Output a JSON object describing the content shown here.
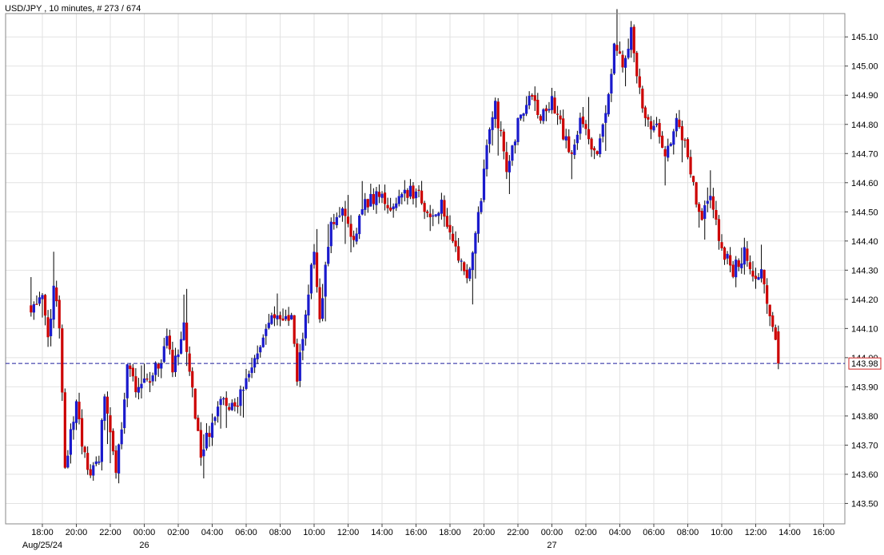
{
  "window": {
    "title": "USD/JPY , 10 minutes, # 273 / 674"
  },
  "current_price_label": "143.98",
  "chart_data": {
    "type": "candlestick",
    "symbol": "USD/JPY",
    "timeframe": "10 minutes",
    "ylim": [
      143.43,
      145.18
    ],
    "y_ticks": [
      "145.10",
      "145.00",
      "144.90",
      "144.80",
      "144.70",
      "144.60",
      "144.50",
      "144.40",
      "144.30",
      "144.20",
      "144.10",
      "144.00",
      "143.90",
      "143.80",
      "143.70",
      "143.60",
      "143.50"
    ],
    "x_ticks": [
      "18:00",
      "20:00",
      "22:00",
      "00:00",
      "02:00",
      "04:00",
      "06:00",
      "08:00",
      "10:00",
      "12:00",
      "14:00",
      "16:00",
      "18:00",
      "20:00",
      "22:00",
      "00:00",
      "02:00",
      "04:00",
      "06:00",
      "08:00",
      "10:00",
      "12:00",
      "14:00",
      "16:00"
    ],
    "date_labels": [
      {
        "label": "Aug/25/24",
        "at_tick": 0
      },
      {
        "label": "26",
        "at_tick": 3
      },
      {
        "label": "27",
        "at_tick": 15
      }
    ],
    "current_price": 143.98,
    "grid": true,
    "up_color": "#1a1acc",
    "down_color": "#cc0000",
    "price_line_color": "#1f1f9c",
    "keypoints": [
      {
        "t": "17:20",
        "v": 144.18
      },
      {
        "t": "18:00",
        "v": 144.2
      },
      {
        "t": "18:20",
        "v": 144.05
      },
      {
        "t": "18:40",
        "v": 144.25
      },
      {
        "t": "19:00",
        "v": 144.1
      },
      {
        "t": "19:20",
        "v": 143.63
      },
      {
        "t": "20:00",
        "v": 143.83
      },
      {
        "t": "20:40",
        "v": 143.6
      },
      {
        "t": "21:20",
        "v": 143.65
      },
      {
        "t": "21:40",
        "v": 143.88
      },
      {
        "t": "22:20",
        "v": 143.58
      },
      {
        "t": "23:00",
        "v": 143.97
      },
      {
        "t": "23:40",
        "v": 143.88
      },
      {
        "t": "00:40",
        "v": 143.96
      },
      {
        "t": "01:20",
        "v": 144.05
      },
      {
        "t": "01:40",
        "v": 143.96
      },
      {
        "t": "02:20",
        "v": 144.1
      },
      {
        "t": "02:40",
        "v": 143.95
      },
      {
        "t": "03:20",
        "v": 143.67
      },
      {
        "t": "03:50",
        "v": 143.75
      },
      {
        "t": "04:20",
        "v": 143.85
      },
      {
        "t": "05:20",
        "v": 143.82
      },
      {
        "t": "06:40",
        "v": 144.03
      },
      {
        "t": "07:20",
        "v": 144.12
      },
      {
        "t": "08:00",
        "v": 144.14
      },
      {
        "t": "08:40",
        "v": 144.13
      },
      {
        "t": "09:00",
        "v": 143.94
      },
      {
        "t": "09:40",
        "v": 144.22
      },
      {
        "t": "10:00",
        "v": 144.38
      },
      {
        "t": "10:20",
        "v": 144.12
      },
      {
        "t": "11:00",
        "v": 144.47
      },
      {
        "t": "11:40",
        "v": 144.5
      },
      {
        "t": "12:20",
        "v": 144.4
      },
      {
        "t": "12:50",
        "v": 144.52
      },
      {
        "t": "14:00",
        "v": 144.57
      },
      {
        "t": "14:30",
        "v": 144.51
      },
      {
        "t": "15:30",
        "v": 144.57
      },
      {
        "t": "16:10",
        "v": 144.55
      },
      {
        "t": "16:50",
        "v": 144.47
      },
      {
        "t": "17:30",
        "v": 144.52
      },
      {
        "t": "18:20",
        "v": 144.38
      },
      {
        "t": "19:00",
        "v": 144.27
      },
      {
        "t": "19:40",
        "v": 144.48
      },
      {
        "t": "20:20",
        "v": 144.8
      },
      {
        "t": "20:40",
        "v": 144.86
      },
      {
        "t": "21:20",
        "v": 144.65
      },
      {
        "t": "22:00",
        "v": 144.8
      },
      {
        "t": "22:40",
        "v": 144.9
      },
      {
        "t": "23:20",
        "v": 144.82
      },
      {
        "t": "00:00",
        "v": 144.88
      },
      {
        "t": "00:40",
        "v": 144.77
      },
      {
        "t": "01:10",
        "v": 144.68
      },
      {
        "t": "01:40",
        "v": 144.82
      },
      {
        "t": "02:40",
        "v": 144.68
      },
      {
        "t": "03:20",
        "v": 144.88
      },
      {
        "t": "03:40",
        "v": 145.1
      },
      {
        "t": "04:10",
        "v": 144.98
      },
      {
        "t": "04:40",
        "v": 145.12
      },
      {
        "t": "05:20",
        "v": 144.85
      },
      {
        "t": "05:40",
        "v": 144.8
      },
      {
        "t": "06:20",
        "v": 144.78
      },
      {
        "t": "06:40",
        "v": 144.7
      },
      {
        "t": "07:20",
        "v": 144.8
      },
      {
        "t": "08:00",
        "v": 144.7
      },
      {
        "t": "08:40",
        "v": 144.48
      },
      {
        "t": "09:20",
        "v": 144.55
      },
      {
        "t": "10:00",
        "v": 144.38
      },
      {
        "t": "10:40",
        "v": 144.3
      },
      {
        "t": "11:20",
        "v": 144.36
      },
      {
        "t": "11:50",
        "v": 144.26
      },
      {
        "t": "12:20",
        "v": 144.28
      },
      {
        "t": "12:40",
        "v": 144.18
      },
      {
        "t": "13:00",
        "v": 144.12
      },
      {
        "t": "13:20",
        "v": 143.98
      }
    ]
  }
}
